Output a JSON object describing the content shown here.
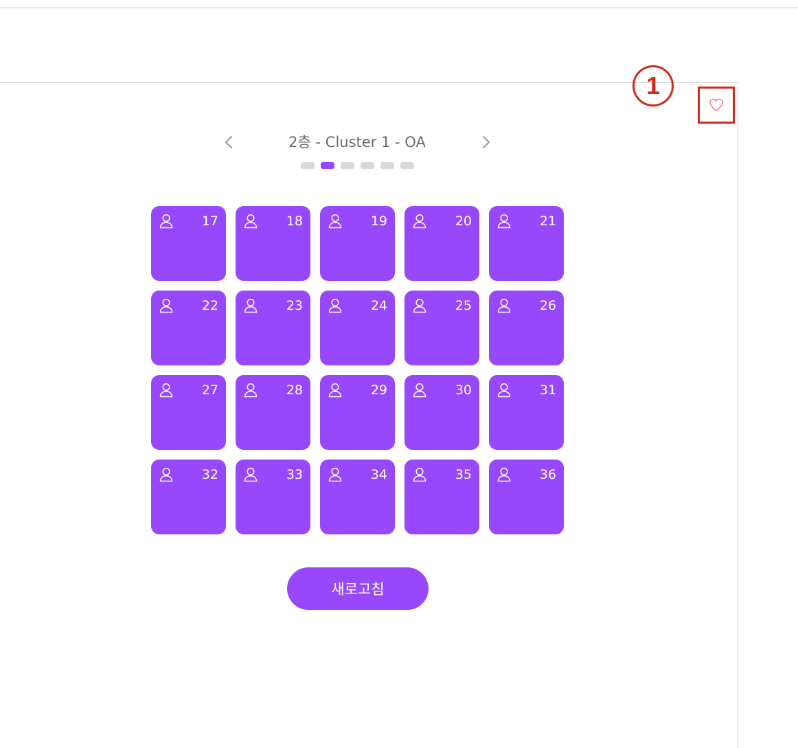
{
  "annotation": {
    "marker_label": "1"
  },
  "favorite": {
    "icon": "heart-icon"
  },
  "navigator": {
    "title": "2층 - Cluster 1 - OA",
    "prev_icon": "chevron-left-icon",
    "next_icon": "chevron-right-icon",
    "page_count": 6,
    "active_page": 2
  },
  "seats": [
    {
      "number": "17"
    },
    {
      "number": "18"
    },
    {
      "number": "19"
    },
    {
      "number": "20"
    },
    {
      "number": "21"
    },
    {
      "number": "22"
    },
    {
      "number": "23"
    },
    {
      "number": "24"
    },
    {
      "number": "25"
    },
    {
      "number": "26"
    },
    {
      "number": "27"
    },
    {
      "number": "28"
    },
    {
      "number": "29"
    },
    {
      "number": "30"
    },
    {
      "number": "31"
    },
    {
      "number": "32"
    },
    {
      "number": "33"
    },
    {
      "number": "34"
    },
    {
      "number": "35"
    },
    {
      "number": "36"
    }
  ],
  "seat_icon": "user-icon",
  "refresh": {
    "label": "새로고침"
  },
  "colors": {
    "accent": "#9848fb",
    "annotation_red": "#d12a1a",
    "heart_pink": "#f2748c",
    "dot_inactive": "#d9d9d9",
    "title_gray": "#6a6a6a"
  }
}
